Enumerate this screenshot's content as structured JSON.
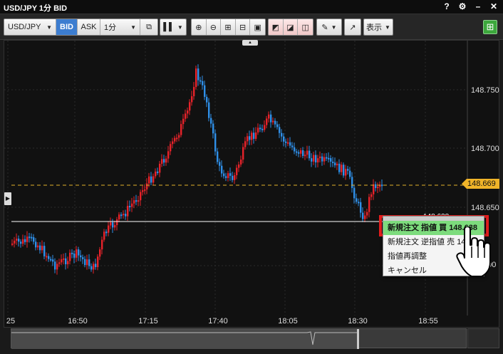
{
  "window": {
    "title": "USD/JPY 1分 BID"
  },
  "toolbar": {
    "symbol": "USD/JPY",
    "bid_label": "BID",
    "ask_label": "ASK",
    "timeframe": "1分",
    "display_label": "表示"
  },
  "chart": {
    "y_ticks": [
      "148.750",
      "148.700",
      "148.650"
    ],
    "y_partial": "600",
    "x_ticks": [
      "25",
      "16:50",
      "17:15",
      "17:40",
      "18:05",
      "18:30",
      "18:55"
    ],
    "current_price": "148.669",
    "order_line_label": "148.638",
    "colors": {
      "up": "#e8222a",
      "down": "#2f8fe8",
      "current_line": "#e2b12a",
      "order_line": "#ffffff"
    }
  },
  "context_menu": {
    "items": [
      {
        "label": "新規注文 指値 買",
        "value": "148.638"
      },
      {
        "label": "新規注文 逆指値 売",
        "value": "148"
      },
      {
        "label": "指値再調整",
        "value": ""
      },
      {
        "label": "キャンセル",
        "value": ""
      }
    ]
  },
  "chart_data": {
    "type": "candlestick",
    "x": [
      "25",
      "16:50",
      "17:15",
      "17:40",
      "18:05",
      "18:30",
      "18:55"
    ],
    "y_ticks": [
      148.75,
      148.7,
      148.65
    ],
    "ylim": [
      148.57,
      148.795
    ],
    "current_price": 148.669,
    "order_line": 148.638,
    "series": [
      {
        "name": "",
        "values": [
          148.64,
          148.66,
          148.74,
          148.7,
          148.72,
          148.7,
          148.63,
          148.669
        ]
      }
    ]
  }
}
